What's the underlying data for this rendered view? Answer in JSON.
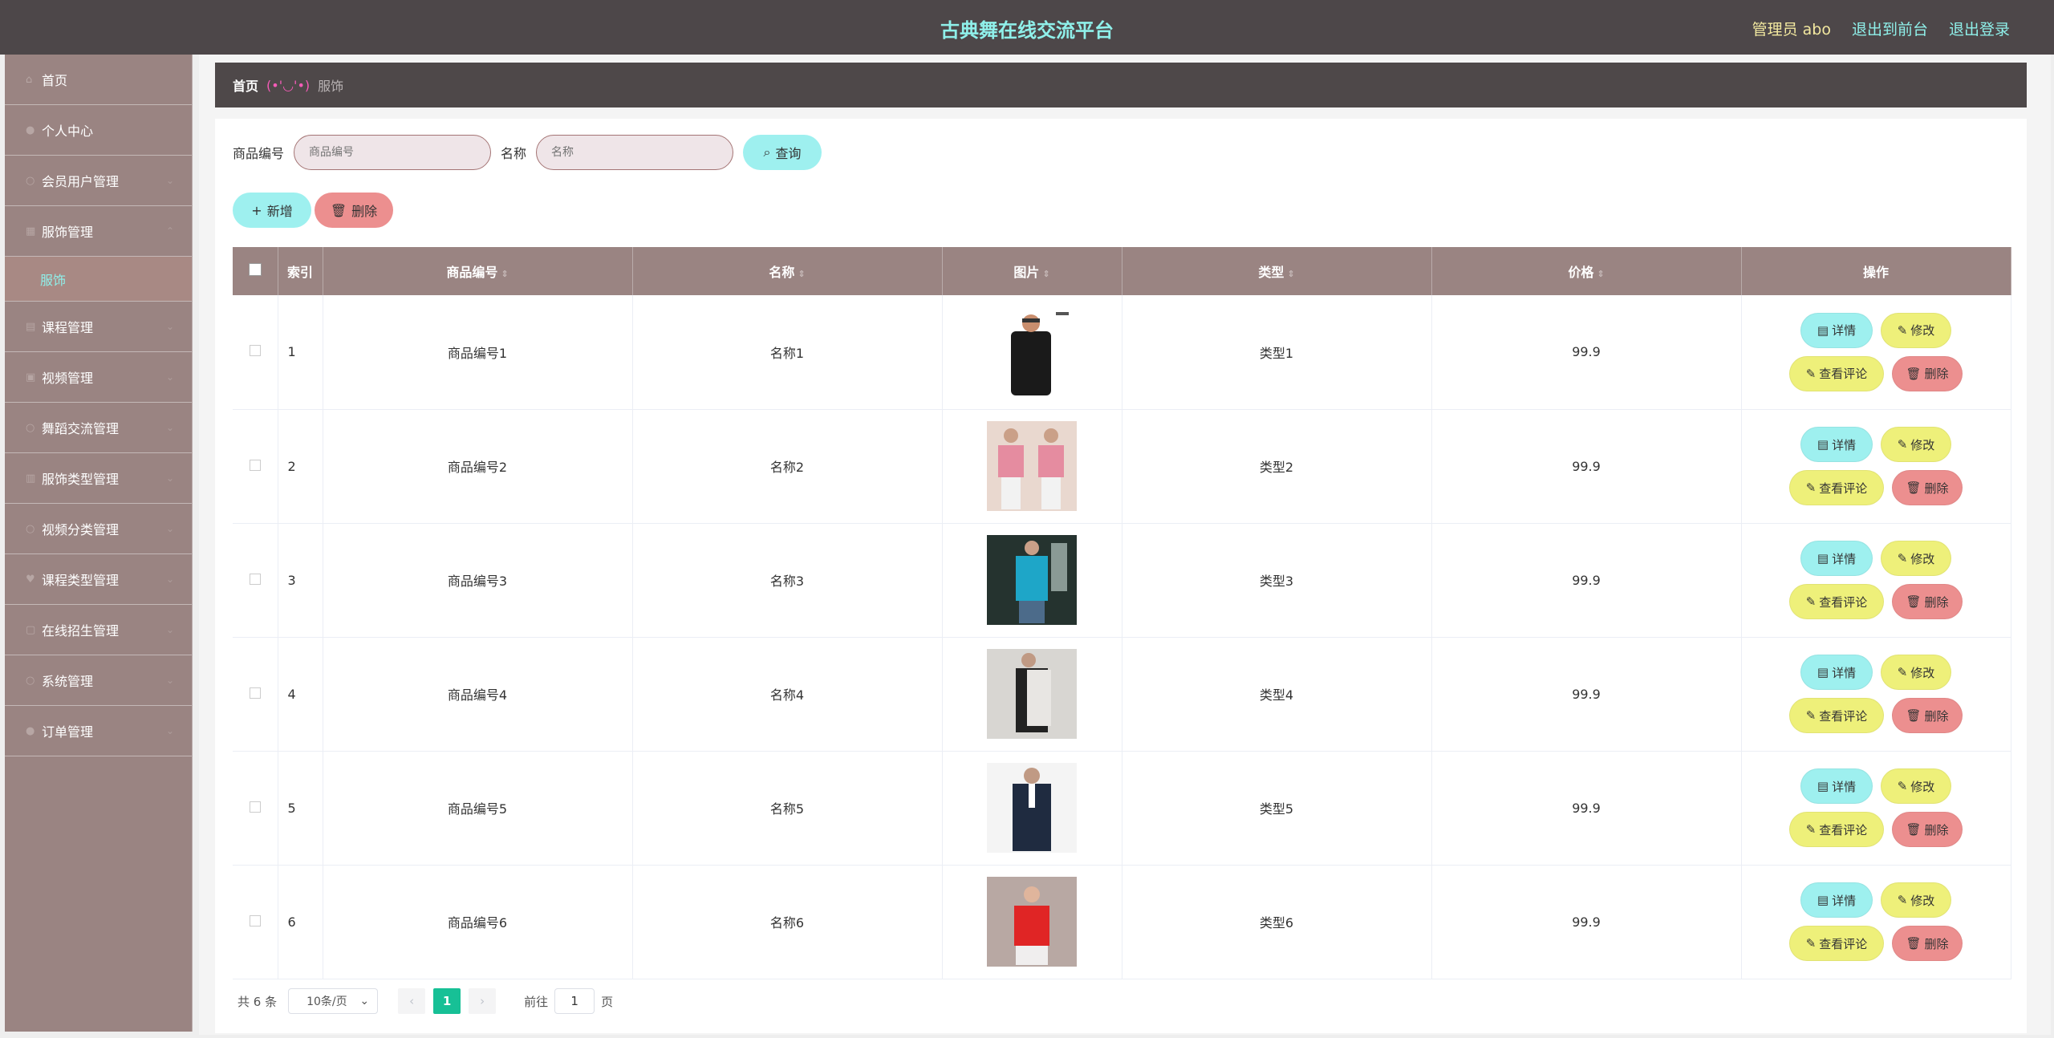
{
  "header": {
    "title": "古典舞在线交流平台",
    "user": "管理员 abo",
    "to_front": "退出到前台",
    "logout": "退出登录"
  },
  "sidebar": {
    "items": [
      {
        "label": "首页",
        "icon": "home-icon"
      },
      {
        "label": "个人中心",
        "icon": "user-icon"
      },
      {
        "label": "会员用户管理",
        "icon": "members-icon"
      },
      {
        "label": "服饰管理",
        "icon": "clothing-icon"
      },
      {
        "label": "课程管理",
        "icon": "course-icon"
      },
      {
        "label": "视频管理",
        "icon": "video-icon"
      },
      {
        "label": "舞蹈交流管理",
        "icon": "chat-icon"
      },
      {
        "label": "服饰类型管理",
        "icon": "category-icon"
      },
      {
        "label": "视频分类管理",
        "icon": "video-category-icon"
      },
      {
        "label": "课程类型管理",
        "icon": "course-type-icon"
      },
      {
        "label": "在线招生管理",
        "icon": "enroll-icon"
      },
      {
        "label": "系统管理",
        "icon": "system-icon"
      },
      {
        "label": "订单管理",
        "icon": "order-icon"
      }
    ],
    "submenu": "服饰"
  },
  "breadcrumb": {
    "home": "首页",
    "sep": "(•'◡'•)",
    "current": "服饰"
  },
  "search": {
    "code_label": "商品编号",
    "code_placeholder": "商品编号",
    "name_label": "名称",
    "name_placeholder": "名称",
    "query": "查询"
  },
  "actions": {
    "add": "新增",
    "delete": "删除"
  },
  "table": {
    "columns": [
      "索引",
      "商品编号",
      "名称",
      "图片",
      "类型",
      "价格",
      "操作"
    ],
    "rows": [
      {
        "index": "1",
        "code": "商品编号1",
        "name": "名称1",
        "type": "类型1",
        "price": "99.9"
      },
      {
        "index": "2",
        "code": "商品编号2",
        "name": "名称2",
        "type": "类型2",
        "price": "99.9"
      },
      {
        "index": "3",
        "code": "商品编号3",
        "name": "名称3",
        "type": "类型3",
        "price": "99.9"
      },
      {
        "index": "4",
        "code": "商品编号4",
        "name": "名称4",
        "type": "类型4",
        "price": "99.9"
      },
      {
        "index": "5",
        "code": "商品编号5",
        "name": "名称5",
        "type": "类型5",
        "price": "99.9"
      },
      {
        "index": "6",
        "code": "商品编号6",
        "name": "名称6",
        "type": "类型6",
        "price": "99.9"
      }
    ],
    "ops": {
      "detail": "详情",
      "edit": "修改",
      "review": "查看评论",
      "delete": "删除"
    }
  },
  "pager": {
    "total": "共 6 条",
    "page_size": "10条/页",
    "current": "1",
    "goto_prefix": "前往",
    "goto_value": "1",
    "goto_suffix": "页"
  },
  "colors": {
    "header_bg": "#4d4749",
    "title": "#8ff0ea",
    "sidebar_bg": "#9a8482",
    "accent_cyan": "#9ef0ef",
    "accent_yellow": "#eef07a",
    "accent_red": "#ec8f8f",
    "pager_active": "#17c096"
  }
}
